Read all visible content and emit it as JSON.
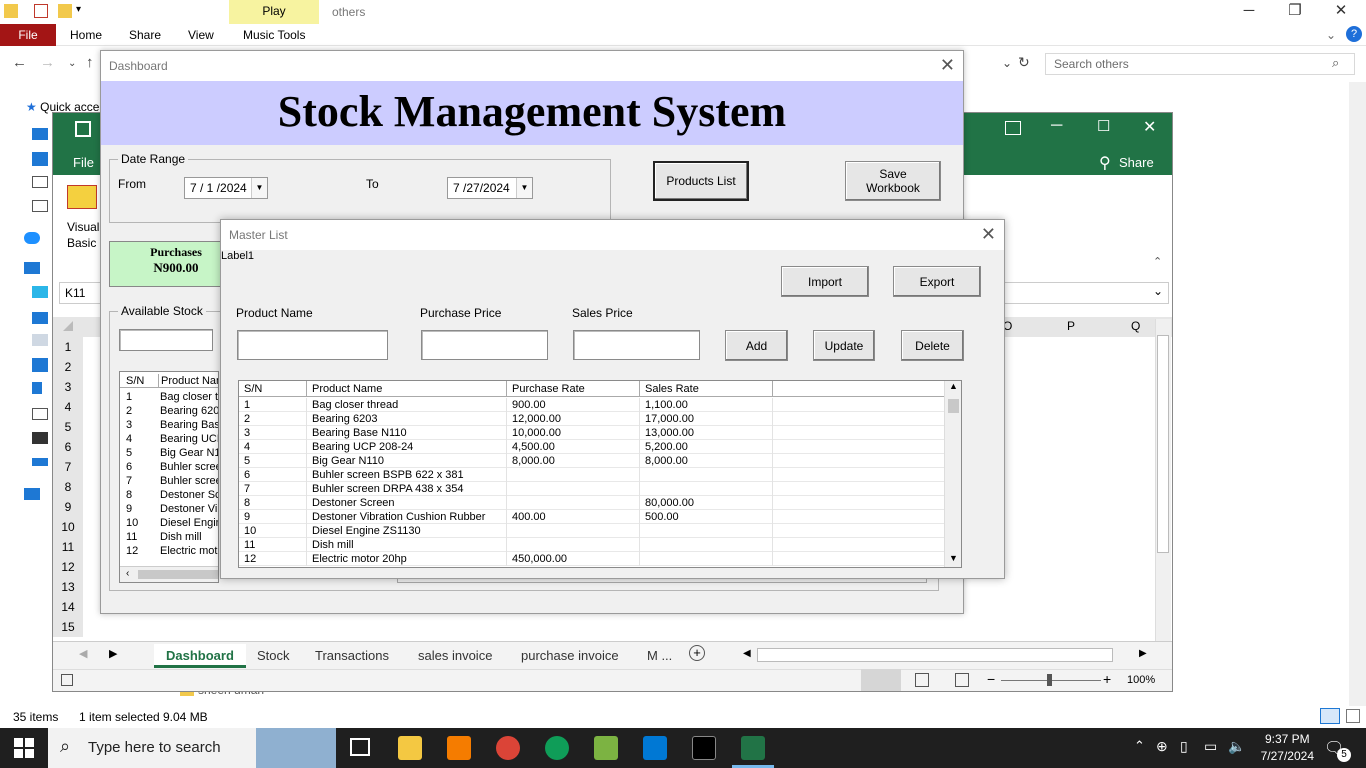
{
  "explorer": {
    "ribbon_tabs": [
      "File",
      "Home",
      "Share",
      "View",
      "Music Tools"
    ],
    "play_tab": "Play",
    "title": "others",
    "search_placeholder": "Search others",
    "nav_quick_access": "Quick acce",
    "status": {
      "items": "35 items",
      "selected": "1 item selected",
      "size": "9.04 MB"
    },
    "partial_file": "sheeh uman"
  },
  "excel": {
    "ribbon_file": "File",
    "share": "Share",
    "name_box": "K11",
    "visual_basic": [
      "Visual",
      "Basic"
    ],
    "columns_right": [
      "O",
      "P",
      "Q"
    ],
    "rows": [
      "1",
      "2",
      "3",
      "4",
      "5",
      "6",
      "7",
      "8",
      "9",
      "10",
      "11",
      "12",
      "13",
      "14",
      "15"
    ],
    "sheet_tabs": [
      "Dashboard",
      "Stock",
      "Transactions",
      "sales invoice",
      "purchase invoice",
      "M ..."
    ],
    "active_sheet": "Dashboard",
    "zoom": "100%"
  },
  "dashboard": {
    "title": "Dashboard",
    "banner": "Stock Management System",
    "date_range_label": "Date Range",
    "from_label": "From",
    "from_value": "7 / 1 /2024",
    "to_label": "To",
    "to_value": "7 /27/2024",
    "products_list_button": "Products List",
    "save_workbook_button": "Save Workbook",
    "purchases_label": "Purchases",
    "purchases_value": "N900.00",
    "available_stock_label": "Available Stock",
    "stock_list_headers": [
      "S/N",
      "Product Nam"
    ],
    "stock_list_rows": [
      [
        "1",
        "Bag closer th"
      ],
      [
        "2",
        "Bearing 6203"
      ],
      [
        "3",
        "Bearing Base"
      ],
      [
        "4",
        "Bearing UCP"
      ],
      [
        "5",
        "Big Gear N11"
      ],
      [
        "6",
        "Buhler screen"
      ],
      [
        "7",
        "Buhler screen"
      ],
      [
        "8",
        "Destoner Scr"
      ],
      [
        "9",
        "Destoner Vib"
      ],
      [
        "10",
        "Diesel Engine"
      ],
      [
        "11",
        "Dish mill"
      ],
      [
        "12",
        "Electric moto"
      ]
    ]
  },
  "master": {
    "title": "Master List",
    "label1": "Label1",
    "import_button": "Import",
    "export_button": "Export",
    "product_name_label": "Product Name",
    "purchase_price_label": "Purchase Price",
    "sales_price_label": "Sales Price",
    "add_button": "Add",
    "update_button": "Update",
    "delete_button": "Delete",
    "headers": [
      "S/N",
      "Product Name",
      "Purchase Rate",
      "Sales Rate"
    ],
    "rows": [
      [
        "1",
        "Bag closer thread",
        "900.00",
        "1,100.00"
      ],
      [
        "2",
        "Bearing 6203",
        "12,000.00",
        "17,000.00"
      ],
      [
        "3",
        "Bearing Base N110",
        "10,000.00",
        "13,000.00"
      ],
      [
        "4",
        "Bearing UCP 208-24",
        "4,500.00",
        "5,200.00"
      ],
      [
        "5",
        "Big Gear N110",
        "8,000.00",
        "8,000.00"
      ],
      [
        "6",
        "Buhler screen BSPB 622 x 381",
        "",
        ""
      ],
      [
        "7",
        "Buhler screen DRPA 438 x 354",
        "",
        ""
      ],
      [
        "8",
        "Destoner Screen",
        "",
        "80,000.00"
      ],
      [
        "9",
        "Destoner Vibration Cushion  Rubber",
        "400.00",
        "500.00"
      ],
      [
        "10",
        "Diesel Engine ZS1130",
        "",
        ""
      ],
      [
        "11",
        "Dish mill",
        "",
        ""
      ],
      [
        "12",
        "Electric motor  20hp",
        "450,000.00",
        ""
      ]
    ]
  },
  "taskbar": {
    "search_placeholder": "Type here to search",
    "time": "9:37 PM",
    "date": "7/27/2024",
    "notification_count": "5"
  },
  "colors": {
    "excel_green": "#217346",
    "banner": "#ccccff",
    "purchases_bg": "#c7f5c7",
    "explorer_file_tab": "#a31515"
  }
}
